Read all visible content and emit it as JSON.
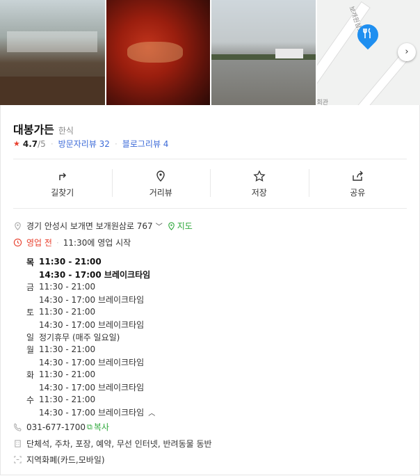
{
  "map": {
    "labels": [
      "보개원삼로",
      "회관"
    ]
  },
  "place": {
    "name": "대봉가든",
    "category": "한식"
  },
  "rating": {
    "score": "4.7",
    "max": "/5",
    "visitor_review": "방문자리뷰 32",
    "blog_review": "블로그리뷰 4"
  },
  "actions": [
    {
      "label": "길찾기",
      "icon": "directions-icon"
    },
    {
      "label": "거리뷰",
      "icon": "location-pin-icon"
    },
    {
      "label": "저장",
      "icon": "star-icon"
    },
    {
      "label": "공유",
      "icon": "share-icon"
    }
  ],
  "address": {
    "text": "경기 안성시 보개면 보개원삼로 767",
    "map_link": "지도"
  },
  "status": {
    "state": "영업 전",
    "detail": "11:30에 영업 시작"
  },
  "hours": [
    {
      "day": "목",
      "time": "11:30 - 21:00",
      "bold": true
    },
    {
      "day": "",
      "time": "14:30 - 17:00 브레이크타임",
      "bold": true
    },
    {
      "day": "금",
      "time": "11:30 - 21:00",
      "bold": false
    },
    {
      "day": "",
      "time": "14:30 - 17:00 브레이크타임",
      "bold": false
    },
    {
      "day": "토",
      "time": "11:30 - 21:00",
      "bold": false
    },
    {
      "day": "",
      "time": "14:30 - 17:00 브레이크타임",
      "bold": false
    },
    {
      "day": "일",
      "time": "정기휴무 (매주 일요일)",
      "bold": false
    },
    {
      "day": "월",
      "time": "11:30 - 21:00",
      "bold": false
    },
    {
      "day": "",
      "time": "14:30 - 17:00 브레이크타임",
      "bold": false
    },
    {
      "day": "화",
      "time": "11:30 - 21:00",
      "bold": false
    },
    {
      "day": "",
      "time": "14:30 - 17:00 브레이크타임",
      "bold": false
    },
    {
      "day": "수",
      "time": "11:30 - 21:00",
      "bold": false
    },
    {
      "day": "",
      "time": "14:30 - 17:00 브레이크타임",
      "bold": false
    }
  ],
  "phone": {
    "number": "031-677-1700",
    "copy": "복사"
  },
  "amenities": "단체석, 주차, 포장, 예약, 무선 인터넷, 반려동물 동반",
  "payment": "지역화폐(카드,모바일)",
  "colors": {
    "accent_red": "#e8402e",
    "link_blue": "#3d6bd8",
    "green": "#2ea83b",
    "pin_blue": "#1f8ff0"
  }
}
